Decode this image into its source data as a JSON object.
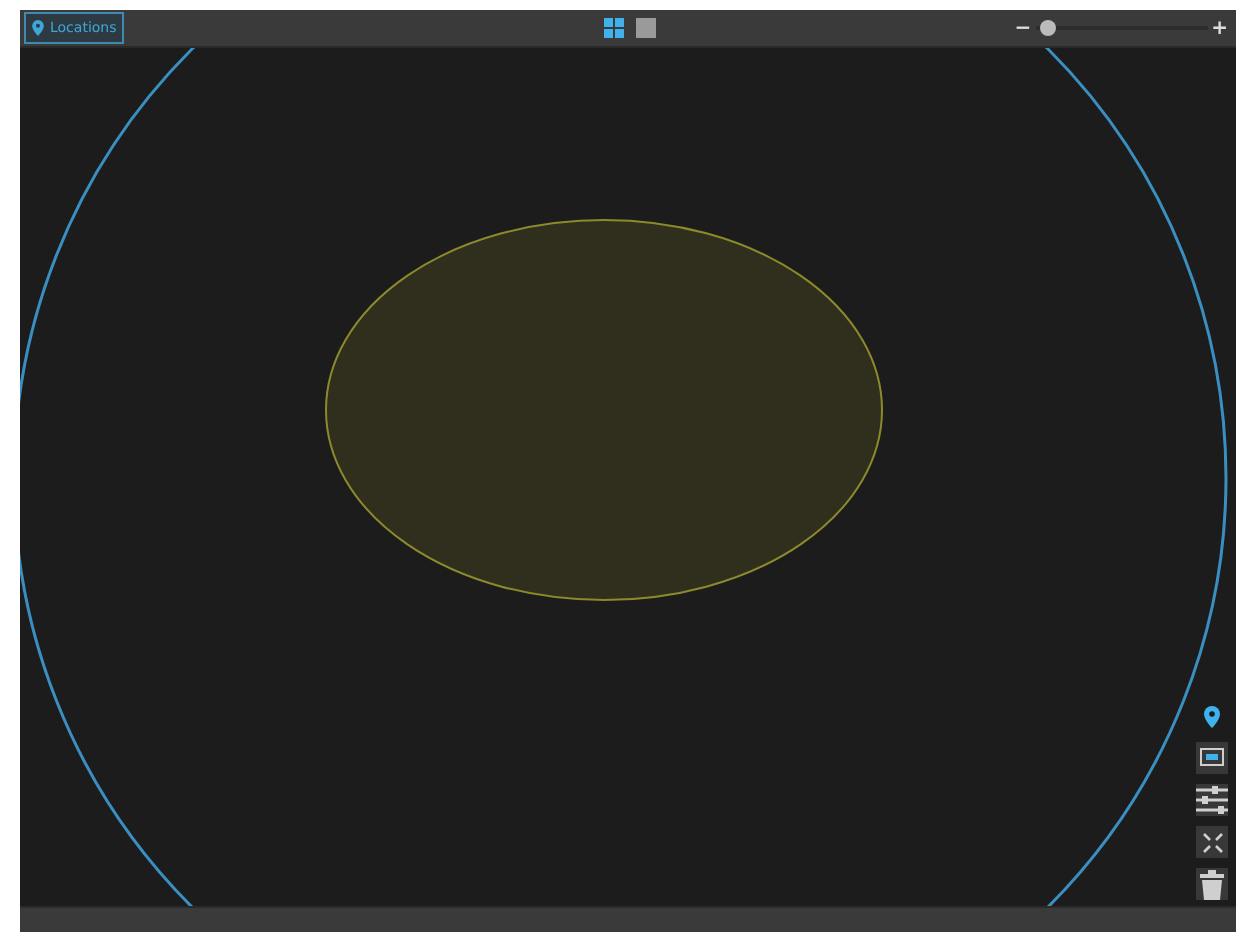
{
  "toolbar": {
    "locations_button": {
      "label": "Locations",
      "selected": true
    },
    "view_modes": [
      {
        "kind": "grid",
        "selected": true
      },
      {
        "kind": "single",
        "selected": false
      }
    ],
    "zoom": {
      "minus": "−",
      "plus": "+",
      "level": 0.08
    }
  },
  "side_tools": [
    {
      "kind": "pin",
      "selected": true
    },
    {
      "kind": "screen",
      "selected": false
    },
    {
      "kind": "sliders",
      "selected": false
    },
    {
      "kind": "fit",
      "selected": false
    },
    {
      "kind": "trash",
      "selected": false
    }
  ]
}
